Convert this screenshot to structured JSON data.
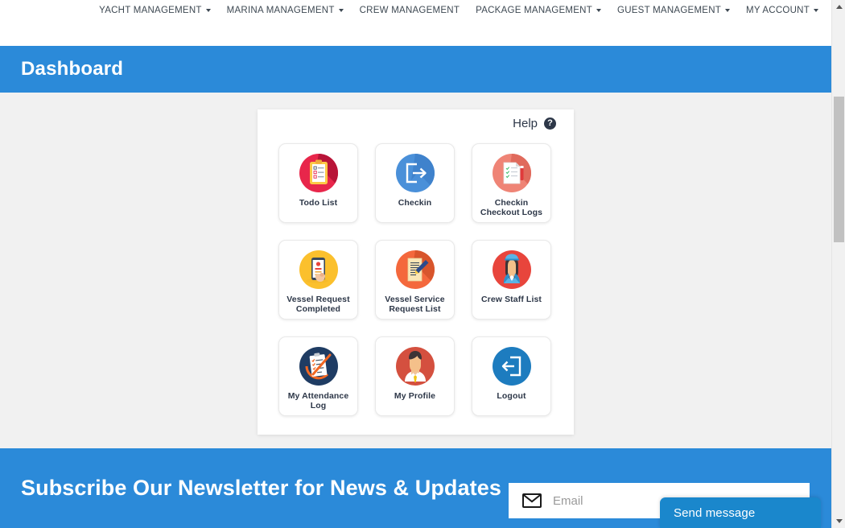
{
  "nav": {
    "items": [
      {
        "label": "YACHT MANAGEMENT",
        "has_caret": true
      },
      {
        "label": "MARINA MANAGEMENT",
        "has_caret": true
      },
      {
        "label": "CREW MANAGEMENT",
        "has_caret": false
      },
      {
        "label": "PACKAGE MANAGEMENT",
        "has_caret": true
      },
      {
        "label": "GUEST MANAGEMENT",
        "has_caret": true
      },
      {
        "label": "MY ACCOUNT",
        "has_caret": true
      }
    ]
  },
  "page": {
    "title": "Dashboard",
    "band_color": "#2b8ad9",
    "background_color": "#f1f1f1"
  },
  "panel": {
    "help": {
      "label": "Help",
      "icon": "question-mark-circle-icon"
    },
    "tiles": [
      {
        "label": "Todo List",
        "icon": "clipboard-checklist-icon",
        "circle_color": "#e8264b"
      },
      {
        "label": "Checkin",
        "icon": "sign-in-arrow-icon",
        "circle_color": "#4a90d9"
      },
      {
        "label": "Checkin\nCheckout Logs",
        "icon": "document-checklist-pen-icon",
        "circle_color": "#ef8476"
      },
      {
        "label": "Vessel Request\nCompleted",
        "icon": "mobile-phone-tap-icon",
        "circle_color": "#fbc02d"
      },
      {
        "label": "Vessel Service\nRequest List",
        "icon": "document-pen-icon",
        "circle_color": "#f4683c"
      },
      {
        "label": "Crew Staff List",
        "icon": "crew-member-avatar-icon",
        "circle_color": "#e8453c"
      },
      {
        "label": "My Attendance\nLog",
        "icon": "attendance-clipboard-icon",
        "circle_color": "#1f3c63"
      },
      {
        "label": "My Profile",
        "icon": "user-avatar-icon",
        "circle_color": "#d4503f"
      },
      {
        "label": "Logout",
        "icon": "logout-arrow-icon",
        "circle_color": "#1d7cbf"
      }
    ]
  },
  "newsletter": {
    "title": "Subscribe Our Newsletter for News & Updates",
    "email_placeholder": "Email",
    "email_value": "",
    "mail_icon": "envelope-icon"
  },
  "chat": {
    "label": "Send message",
    "color": "#1a87cc"
  },
  "scrollbar": {
    "up_icon": "scroll-up-arrow-icon",
    "down_icon": "scroll-down-arrow-icon"
  }
}
